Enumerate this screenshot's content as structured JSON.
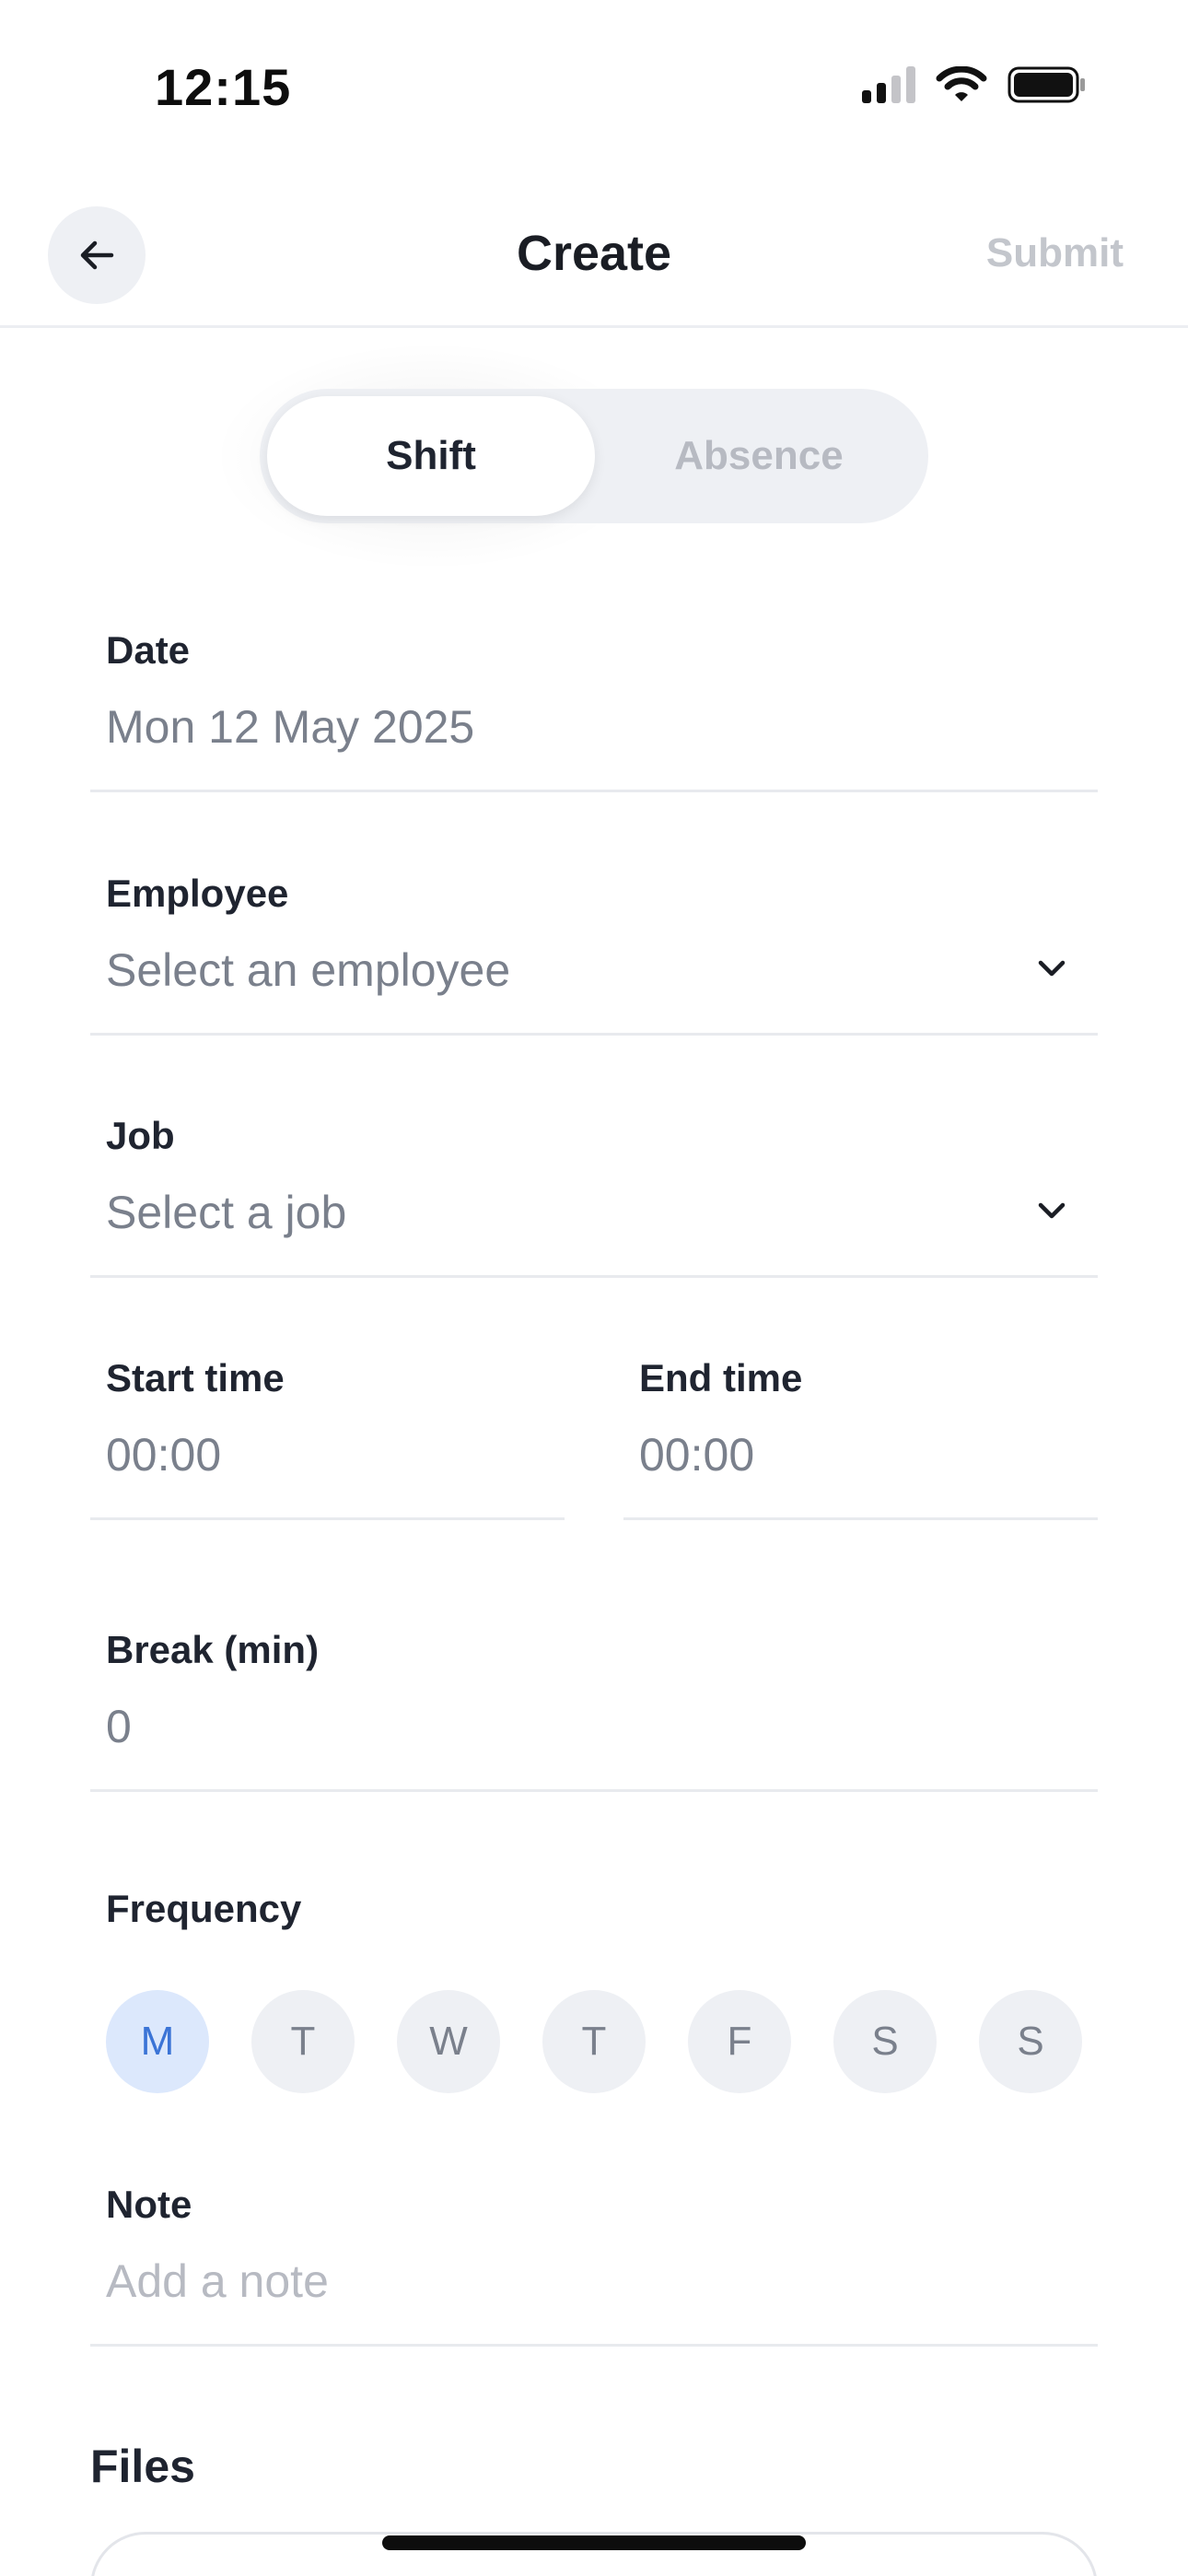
{
  "status_bar": {
    "time": "12:15"
  },
  "nav": {
    "title": "Create",
    "submit_label": "Submit"
  },
  "segment": {
    "shift_label": "Shift",
    "absence_label": "Absence",
    "selected": "Shift"
  },
  "form": {
    "date": {
      "label": "Date",
      "value": "Mon 12 May 2025"
    },
    "employee": {
      "label": "Employee",
      "placeholder": "Select an employee"
    },
    "job": {
      "label": "Job",
      "placeholder": "Select a job"
    },
    "start_time": {
      "label": "Start time",
      "placeholder": "00:00"
    },
    "end_time": {
      "label": "End time",
      "placeholder": "00:00"
    },
    "break": {
      "label": "Break (min)",
      "placeholder": "0"
    },
    "frequency": {
      "label": "Frequency",
      "days": [
        "M",
        "T",
        "W",
        "T",
        "F",
        "S",
        "S"
      ],
      "selected_index": 0
    },
    "note": {
      "label": "Note",
      "placeholder": "Add a note"
    }
  },
  "files": {
    "title": "Files"
  },
  "colors": {
    "accent": "#3b74d6",
    "accent_bg": "#dce8fc",
    "chip_bg": "#eef0f4",
    "placeholder": "#7a808c",
    "muted": "#c3c6cc"
  }
}
